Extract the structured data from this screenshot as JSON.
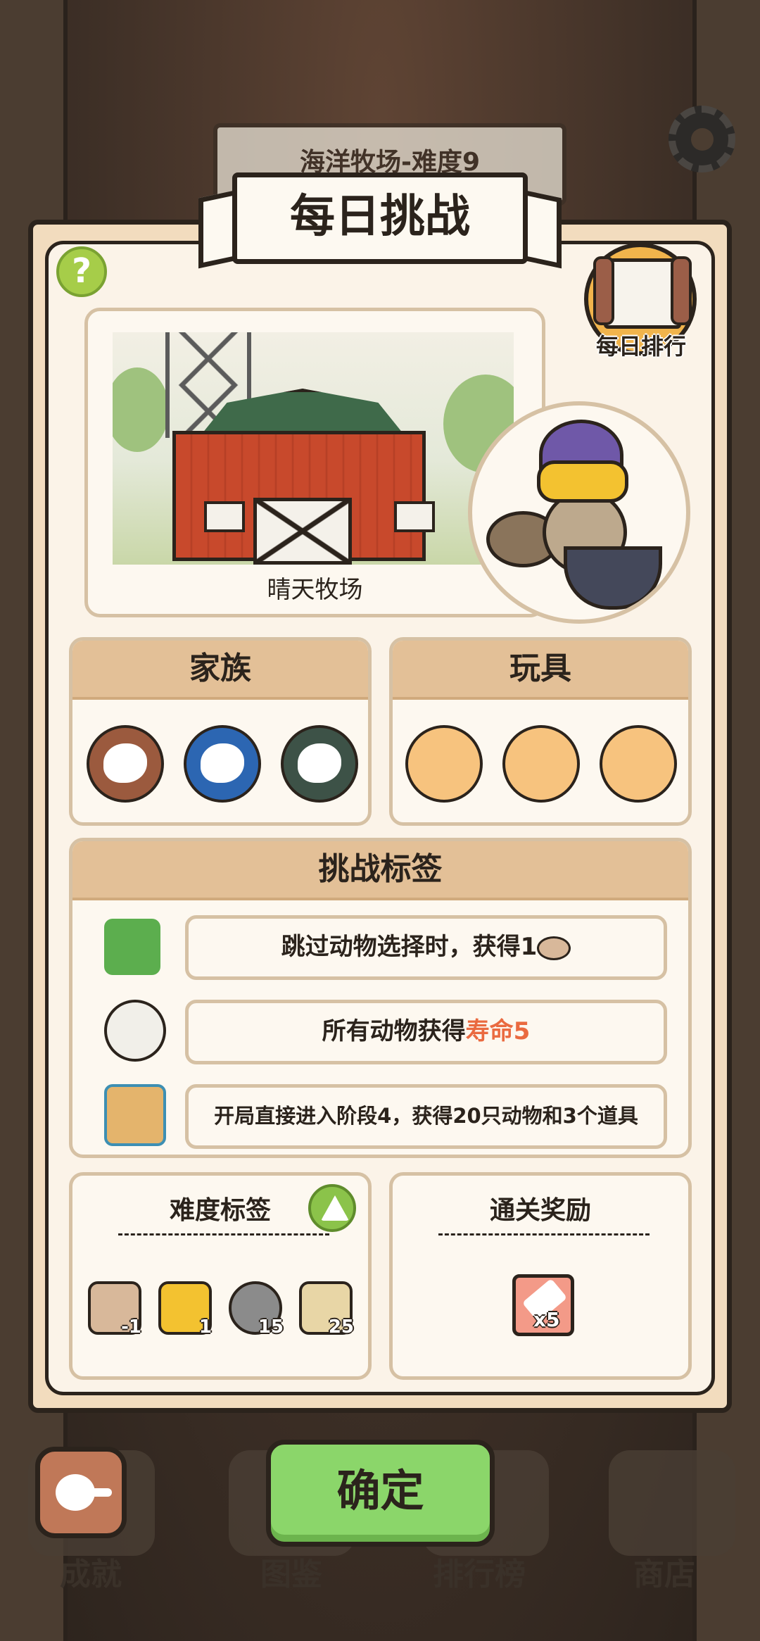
{
  "background": {
    "stage_sign": "海洋牧场-难度9",
    "nav": [
      {
        "label": "成就"
      },
      {
        "label": "图鉴"
      },
      {
        "label": "排行榜"
      },
      {
        "label": "商店"
      }
    ]
  },
  "dialog": {
    "title": "每日挑战",
    "ranking_label": "每日排行",
    "map_name": "晴天牧场",
    "family": {
      "header": "家族",
      "icons": [
        "family-icon-brown",
        "family-icon-blue",
        "family-icon-green"
      ]
    },
    "toys": {
      "header": "玩具",
      "icons": [
        "toy-wand-icon",
        "toy-jar-icon",
        "toy-doll-icon"
      ]
    },
    "challenge": {
      "header": "挑战标签",
      "tags": [
        {
          "text": "跳过动物选择时，获得1",
          "icon": "recycle-bin-icon"
        },
        {
          "text": "所有动物获得",
          "highlight": "寿命5",
          "icon": "lifespan-icon"
        },
        {
          "text": "开局直接进入阶段4，获得20只动物和3个道具",
          "icon": "board-icon"
        }
      ]
    },
    "difficulty": {
      "title": "难度标签",
      "items": [
        {
          "icon": "can-icon",
          "value": "-1"
        },
        {
          "icon": "barrier-icon",
          "value": "1"
        },
        {
          "icon": "face-timer-icon",
          "value": "15"
        },
        {
          "icon": "barrier-timer-icon",
          "value": "25"
        }
      ]
    },
    "reward": {
      "title": "通关奖励",
      "icon": "eraser-icon",
      "count": "x5"
    },
    "confirm_label": "确定"
  },
  "colors": {
    "panel_bg": "#f2dcbe",
    "header_bg": "#e3c097",
    "confirm_green": "#8bd66a",
    "highlight_orange": "#ea6a40"
  }
}
